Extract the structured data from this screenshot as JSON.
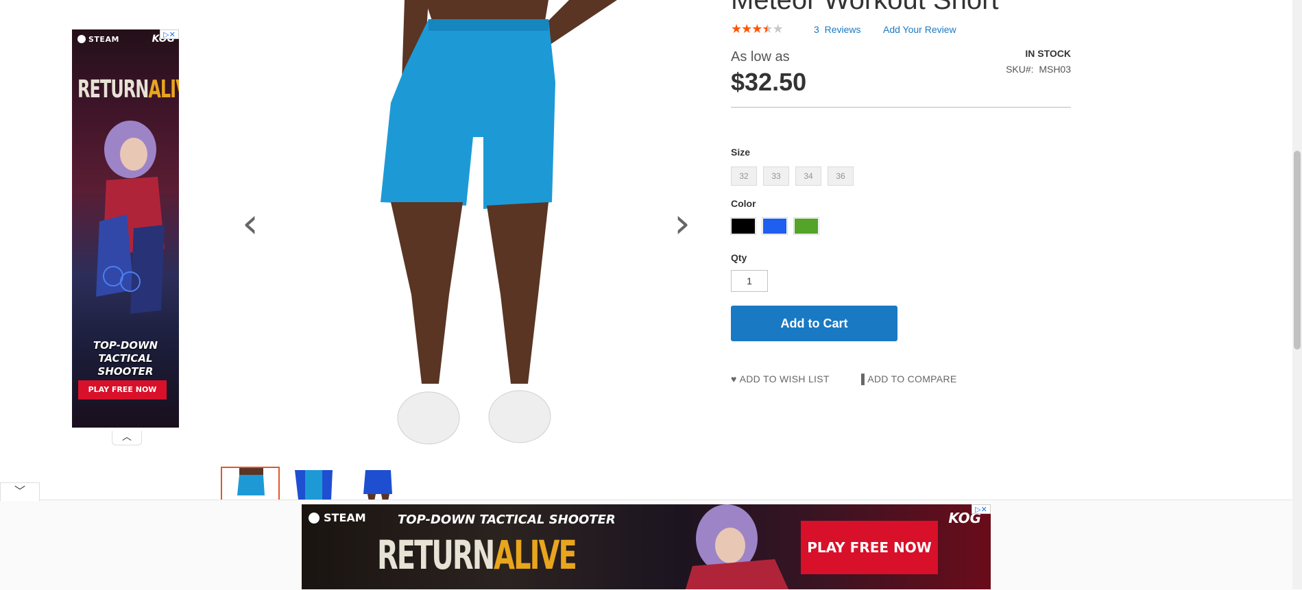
{
  "product": {
    "title": "Meteor Workout Short",
    "rating_stars": 3.5,
    "reviews_count": "3",
    "reviews_label": "Reviews",
    "add_review": "Add Your Review",
    "price_prefix": "As low as",
    "price": "$32.50",
    "stock": "IN STOCK",
    "sku_label": "SKU#:",
    "sku": "MSH03",
    "size_label": "Size",
    "sizes": [
      "32",
      "33",
      "34",
      "36"
    ],
    "color_label": "Color",
    "colors": [
      {
        "name": "Black",
        "hex": "#000000"
      },
      {
        "name": "Blue",
        "hex": "#1e5ef0"
      },
      {
        "name": "Green",
        "hex": "#53a428"
      }
    ],
    "qty_label": "Qty",
    "qty": "1",
    "add_to_cart": "Add to Cart",
    "wishlist": "ADD TO WISH LIST",
    "compare": "ADD TO COMPARE"
  },
  "gallery": {
    "thumbs": [
      "front-blue-shorts",
      "side-blue-shorts",
      "back-blue-shorts"
    ],
    "active_thumb": 0
  },
  "ads": {
    "side": {
      "brand": "STEAM",
      "publisher": "KOG",
      "logo_a": "RETURN",
      "logo_b": "ALIVE",
      "tagline": "TOP-DOWN TACTICAL SHOOTER",
      "cta": "PLAY FREE NOW"
    },
    "bottom": {
      "brand": "STEAM",
      "publisher": "KOG",
      "tagline": "TOP-DOWN TACTICAL SHOOTER",
      "logo_a": "RETURN",
      "logo_b": "ALIVE",
      "cta": "PLAY FREE NOW"
    }
  },
  "colors": {
    "accent": "#1979c3",
    "star": "#ff5501",
    "thumb_active": "#e2562a",
    "ad_red": "#d8102a"
  }
}
